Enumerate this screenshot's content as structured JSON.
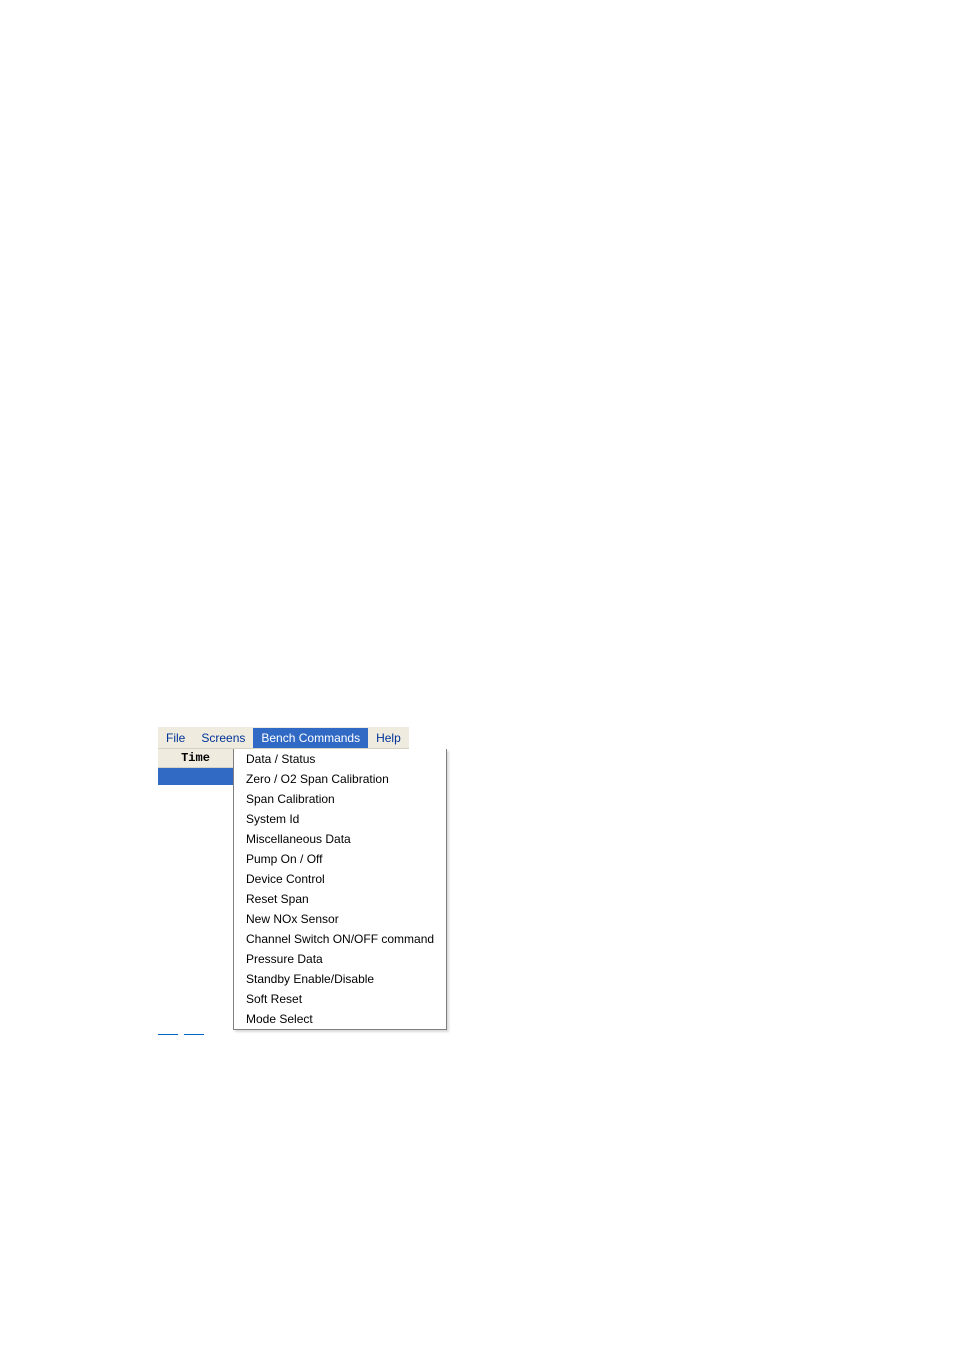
{
  "menubar": {
    "items": [
      {
        "label": "File"
      },
      {
        "label": "Screens"
      },
      {
        "label": "Bench Commands"
      },
      {
        "label": "Help"
      }
    ],
    "activeIndex": 2
  },
  "table": {
    "header": "Time"
  },
  "dropdown": {
    "items": [
      {
        "label": "Data / Status"
      },
      {
        "label": "Zero / O2 Span Calibration"
      },
      {
        "label": "Span Calibration"
      },
      {
        "label": "System Id"
      },
      {
        "label": "Miscellaneous Data"
      },
      {
        "label": "Pump On / Off"
      },
      {
        "label": "Device Control"
      },
      {
        "label": "Reset Span"
      },
      {
        "label": "New NOx Sensor"
      },
      {
        "label": "Channel Switch ON/OFF command"
      },
      {
        "label": "Pressure Data"
      },
      {
        "label": "Standby Enable/Disable"
      },
      {
        "label": "Soft Reset"
      },
      {
        "label": "Mode Select"
      }
    ]
  }
}
